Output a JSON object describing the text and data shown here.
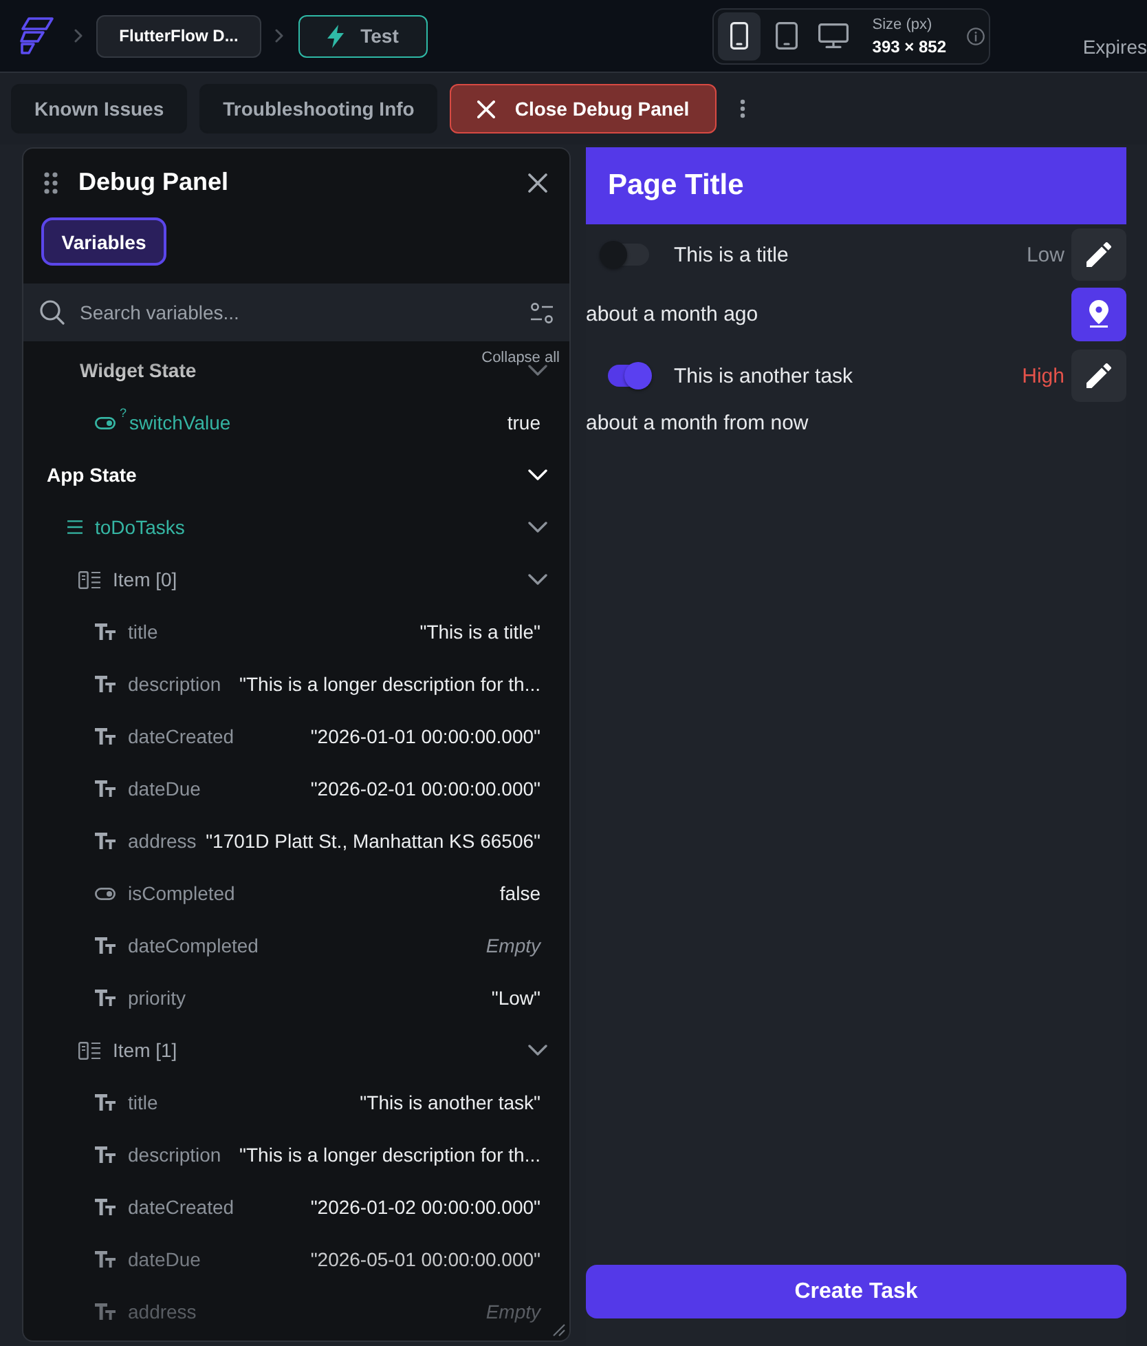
{
  "top_bar": {
    "breadcrumbs": [
      {
        "kind": "project",
        "label": "FlutterFlow D..."
      },
      {
        "kind": "mode",
        "label": "Test"
      }
    ],
    "devices": [
      {
        "kind": "phone",
        "selected": true
      },
      {
        "kind": "tablet",
        "selected": false
      },
      {
        "kind": "desktop",
        "selected": false
      }
    ],
    "size_label": "Size (px)",
    "size_value": "393 × 852",
    "expires": "Expires"
  },
  "toolbar": {
    "buttons": [
      {
        "kind": "plain",
        "label": "Known Issues"
      },
      {
        "kind": "plain",
        "label": "Troubleshooting Info"
      },
      {
        "kind": "close",
        "label": "Close Debug Panel"
      }
    ]
  },
  "debug_panel": {
    "title": "Debug Panel",
    "tabs": [
      {
        "label": "Variables",
        "selected": true
      }
    ],
    "search": {
      "placeholder": "Search variables..."
    },
    "collapse_all": "Collapse all",
    "tree": [
      {
        "kind": "group",
        "label": "Widget State",
        "expanded": true,
        "children": [
          {
            "kind": "bool",
            "label": "switchValue",
            "mark": "?",
            "value": "true",
            "empty": false
          }
        ]
      },
      {
        "kind": "section",
        "label": "App State",
        "expanded": true,
        "children": [
          {
            "kind": "list",
            "label": "toDoTasks",
            "expanded": true,
            "children": [
              {
                "kind": "struct",
                "label": "Item [0]",
                "expanded": true,
                "children": [
                  {
                    "kind": "text",
                    "label": "title",
                    "value": "\"This is a title\"",
                    "empty": false
                  },
                  {
                    "kind": "text",
                    "label": "description",
                    "value": "\"This is a longer description for th...",
                    "empty": false
                  },
                  {
                    "kind": "text",
                    "label": "dateCreated",
                    "value": "\"2026-01-01 00:00:00.000\"",
                    "empty": false
                  },
                  {
                    "kind": "text",
                    "label": "dateDue",
                    "value": "\"2026-02-01 00:00:00.000\"",
                    "empty": false
                  },
                  {
                    "kind": "text",
                    "label": "address",
                    "value": "\"1701D Platt St., Manhattan KS 66506\"",
                    "empty": false
                  },
                  {
                    "kind": "bool",
                    "label": "isCompleted",
                    "value": "false",
                    "empty": false
                  },
                  {
                    "kind": "text",
                    "label": "dateCompleted",
                    "value": "Empty",
                    "empty": true
                  },
                  {
                    "kind": "text",
                    "label": "priority",
                    "value": "\"Low\"",
                    "empty": false
                  }
                ]
              },
              {
                "kind": "struct",
                "label": "Item [1]",
                "expanded": true,
                "children": [
                  {
                    "kind": "text",
                    "label": "title",
                    "value": "\"This is another task\"",
                    "empty": false
                  },
                  {
                    "kind": "text",
                    "label": "description",
                    "value": "\"This is a longer description for th...",
                    "empty": false
                  },
                  {
                    "kind": "text",
                    "label": "dateCreated",
                    "value": "\"2026-01-02 00:00:00.000\"",
                    "empty": false
                  },
                  {
                    "kind": "text",
                    "label": "dateDue",
                    "value": "\"2026-05-01 00:00:00.000\"",
                    "empty": false
                  },
                  {
                    "kind": "text",
                    "label": "address",
                    "value": "Empty",
                    "empty": true
                  }
                ]
              }
            ]
          }
        ]
      }
    ]
  },
  "preview": {
    "header": {
      "title": "Page Title"
    },
    "tasks": [
      {
        "title": "This is a title",
        "done": false,
        "priority": {
          "label": "Low",
          "color": "#8b9199"
        },
        "due": "about a month ago",
        "has_location": true
      },
      {
        "title": "This is another task",
        "done": true,
        "priority": {
          "label": "High",
          "color": "#e5534b"
        },
        "due": "about a month from now",
        "has_location": false
      }
    ],
    "create_button": "Create Task"
  }
}
